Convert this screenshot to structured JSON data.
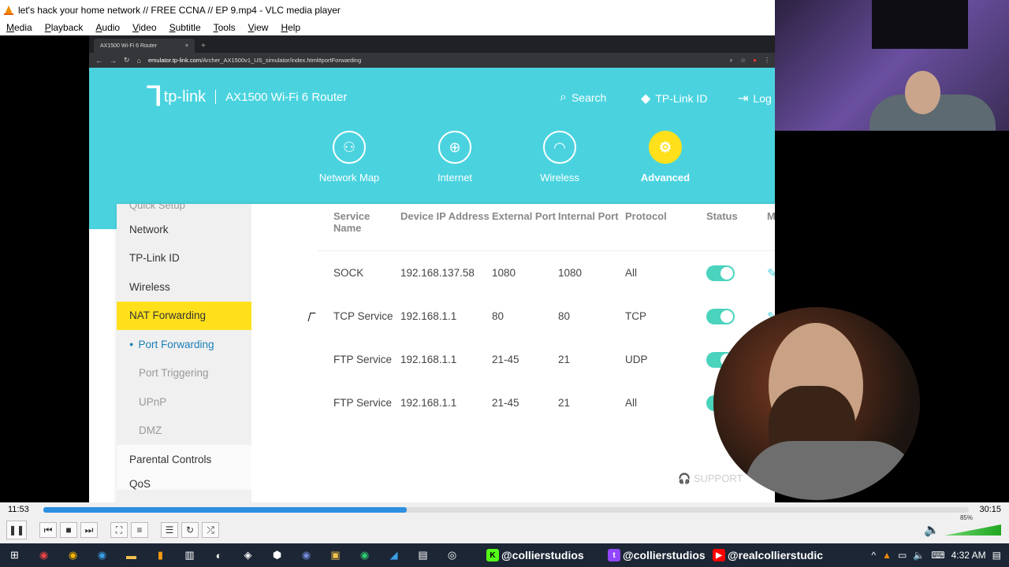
{
  "window": {
    "title": "let's hack your home network // FREE CCNA // EP 9.mp4 - VLC media player"
  },
  "menu": [
    {
      "key": "M",
      "rest": "edia"
    },
    {
      "key": "P",
      "rest": "layback"
    },
    {
      "key": "A",
      "rest": "udio"
    },
    {
      "key": "V",
      "rest": "ideo"
    },
    {
      "key": "S",
      "rest": "ubtitle"
    },
    {
      "key": "T",
      "rest": "ools"
    },
    {
      "key": "V",
      "rest": "iew"
    },
    {
      "key": "H",
      "rest": "elp"
    }
  ],
  "browser": {
    "tab_title": "AX1500 Wi-Fi 6 Router",
    "url_host": "emulator.tp-link.com",
    "url_path": "/Archer_AX1500v1_US_simulator/index.html#portForwarding"
  },
  "router": {
    "brand": "tp-link",
    "model": "AX1500 Wi-Fi 6 Router",
    "top_links": {
      "search": "Search",
      "tplink_id": "TP-Link ID",
      "logout": "Log"
    },
    "nav": [
      {
        "label": "Network Map",
        "icon": "network-map-icon"
      },
      {
        "label": "Internet",
        "icon": "globe-icon"
      },
      {
        "label": "Wireless",
        "icon": "wifi-icon"
      },
      {
        "label": "Advanced",
        "icon": "gear-icon",
        "active": true
      }
    ],
    "sidebar": {
      "partial_top": "Quick Setup",
      "items": [
        "Network",
        "TP-Link ID",
        "Wireless"
      ],
      "active": "NAT Forwarding",
      "sub_active": "Port Forwarding",
      "subs": [
        "Port Triggering",
        "UPnP",
        "DMZ"
      ],
      "after": [
        "Parental Controls",
        "QoS"
      ]
    },
    "table": {
      "headers": [
        "Service Name",
        "Device IP Address",
        "External Port",
        "Internal Port",
        "Protocol",
        "Status",
        "Modify"
      ],
      "rows": [
        [
          "SOCK",
          "192.168.137.58",
          "1080",
          "1080",
          "All"
        ],
        [
          "TCP Service",
          "192.168.1.1",
          "80",
          "80",
          "TCP"
        ],
        [
          "FTP Service",
          "192.168.1.1",
          "21-45",
          "21",
          "UDP"
        ],
        [
          "FTP Service",
          "192.168.1.1",
          "21-45",
          "21",
          "All"
        ]
      ]
    },
    "support": "SUPPORT"
  },
  "player": {
    "elapsed": "11:53",
    "total": "30:15",
    "progress": 0.393,
    "volume": "85%"
  },
  "taskbar": {
    "social1": "@collierstudios",
    "social2": "@collierstudios",
    "social3": "@realcollierstudic",
    "clock": "4:32 AM"
  }
}
